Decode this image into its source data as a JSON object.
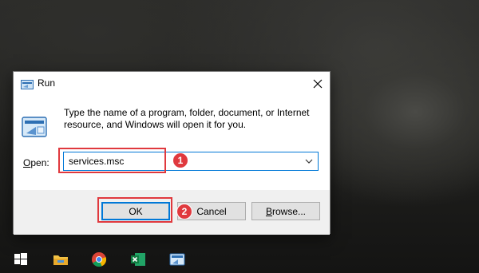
{
  "dialog": {
    "title": "Run",
    "description": "Type the name of a program, folder, document, or Internet resource, and Windows will open it for you.",
    "open_label_accel": "O",
    "open_label_rest": "pen:",
    "open_value": "services.msc",
    "buttons": {
      "ok": "OK",
      "cancel": "Cancel",
      "browse_accel": "B",
      "browse_rest": "rowse..."
    }
  },
  "annotations": {
    "step1": "1",
    "step2": "2",
    "color": "#e0393e"
  },
  "taskbar": {
    "items": [
      "windows-start-icon",
      "file-explorer-icon",
      "chrome-icon",
      "excel-icon",
      "run-app-icon"
    ]
  }
}
